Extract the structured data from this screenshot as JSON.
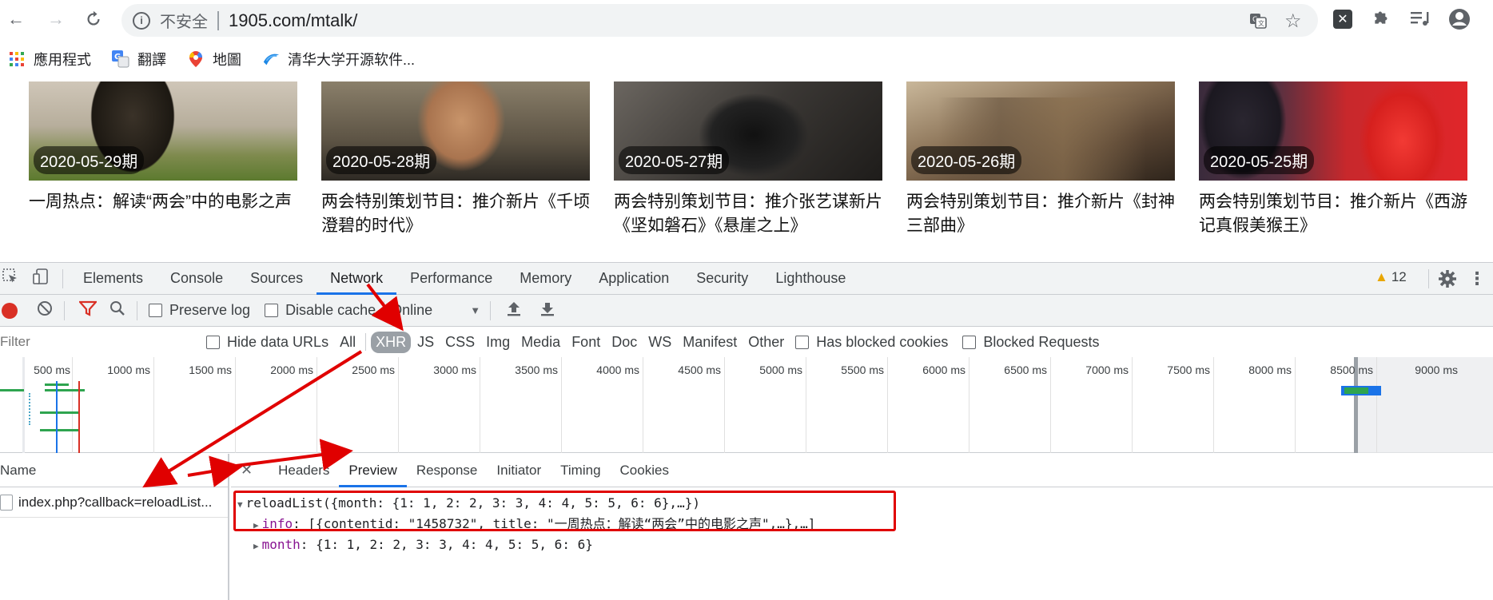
{
  "browser": {
    "security_label": "不安全",
    "url": "1905.com/mtalk/",
    "bookmarks": [
      "應用程式",
      "翻譯",
      "地圖",
      "清华大学开源软件..."
    ]
  },
  "cards": [
    {
      "date": "2020-05-29期",
      "title": "一周热点：解读“两会”中的电影之声"
    },
    {
      "date": "2020-05-28期",
      "title": "两会特别策划节目：推介新片《千顷澄碧的时代》"
    },
    {
      "date": "2020-05-27期",
      "title": "两会特别策划节目：推介张艺谋新片《坚如磐石》《悬崖之上》"
    },
    {
      "date": "2020-05-26期",
      "title": "两会特别策划节目：推介新片《封神三部曲》"
    },
    {
      "date": "2020-05-25期",
      "title": "两会特别策划节目：推介新片《西游记真假美猴王》"
    }
  ],
  "devtools": {
    "tabs": [
      "Elements",
      "Console",
      "Sources",
      "Network",
      "Performance",
      "Memory",
      "Application",
      "Security",
      "Lighthouse"
    ],
    "active_tab": "Network",
    "warning_count": "12",
    "toolbar": {
      "preserve_log": "Preserve log",
      "disable_cache": "Disable cache",
      "throttle": "Online"
    },
    "filter": {
      "placeholder": "Filter",
      "hide_data_urls": "Hide data URLs",
      "types": [
        "All",
        "XHR",
        "JS",
        "CSS",
        "Img",
        "Media",
        "Font",
        "Doc",
        "WS",
        "Manifest",
        "Other"
      ],
      "active_type": "XHR",
      "has_blocked_cookies": "Has blocked cookies",
      "blocked_requests": "Blocked Requests"
    },
    "timeline_ticks": [
      "500 ms",
      "1000 ms",
      "1500 ms",
      "2000 ms",
      "2500 ms",
      "3000 ms",
      "3500 ms",
      "4000 ms",
      "4500 ms",
      "5000 ms",
      "5500 ms",
      "6000 ms",
      "6500 ms",
      "7000 ms",
      "7500 ms",
      "8000 ms",
      "8500 ms",
      "9000 ms"
    ],
    "name_header": "Name",
    "request_name": "index.php?callback=reloadList...",
    "detail_tabs": [
      "Headers",
      "Preview",
      "Response",
      "Initiator",
      "Timing",
      "Cookies"
    ],
    "active_detail_tab": "Preview",
    "preview": {
      "root": "reloadList({month: {1: 1, 2: 2, 3: 3, 4: 4, 5: 5, 6: 6},…})",
      "info_key": "info",
      "info_value": ": [{contentid: \"1458732\", title: \"一周热点：解读“两会”中的电影之声\",…},…]",
      "month_key": "month",
      "month_value": ": {1: 1, 2: 2, 3: 3, 4: 4, 5: 5, 6: 6}"
    }
  },
  "colors": {
    "accent": "#1a73e8",
    "annotation": "#e00000",
    "record": "#d93025",
    "key_purple": "#881391"
  }
}
